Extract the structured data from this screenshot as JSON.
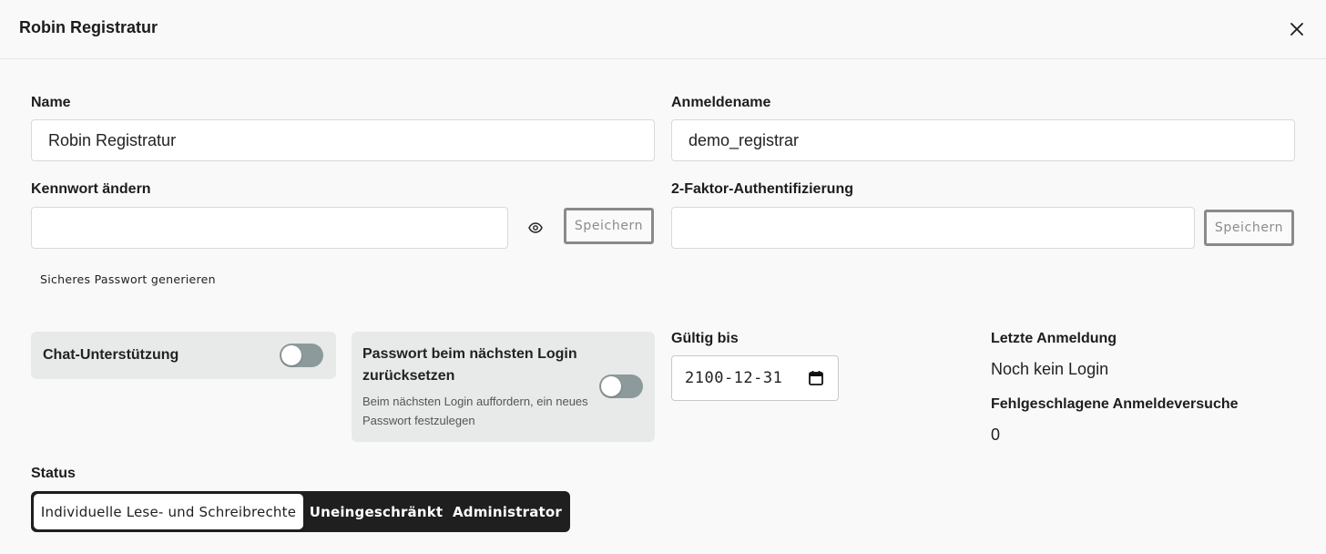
{
  "dialog": {
    "title": "Robin Registratur"
  },
  "form": {
    "name": {
      "label": "Name",
      "value": "Robin Registratur"
    },
    "login_name": {
      "label": "Anmeldename",
      "value": "demo_registrar"
    },
    "password": {
      "label": "Kennwort ändern",
      "value": "",
      "save_label": "Speichern",
      "generate_label": "Sicheres Passwort generieren"
    },
    "two_factor": {
      "label": "2-Faktor-Authentifizierung",
      "value": "",
      "save_label": "Speichern"
    }
  },
  "toggles": {
    "chat": {
      "label": "Chat-Unterstützung",
      "enabled": false
    },
    "reset_password": {
      "title": "Passwort beim nächsten Login zurücksetzen",
      "description": "Beim nächsten Login auffordern, ein neues Passwort festzulegen",
      "enabled": false
    }
  },
  "valid_until": {
    "label": "Gültig bis",
    "value": "2100-12-31"
  },
  "last_login": {
    "label": "Letzte Anmeldung",
    "value": "Noch kein Login"
  },
  "failed_attempts": {
    "label": "Fehlgeschlagene Anmeldeversuche",
    "value": "0"
  },
  "status": {
    "label": "Status",
    "options": [
      "Individuelle Lese- und Schreibrechte",
      "Uneingeschränkt",
      "Administrator"
    ],
    "selected": "Individuelle Lese- und Schreibrechte"
  },
  "icons": {
    "close": "close-icon",
    "eye": "eye-icon",
    "calendar": "calendar-icon"
  }
}
